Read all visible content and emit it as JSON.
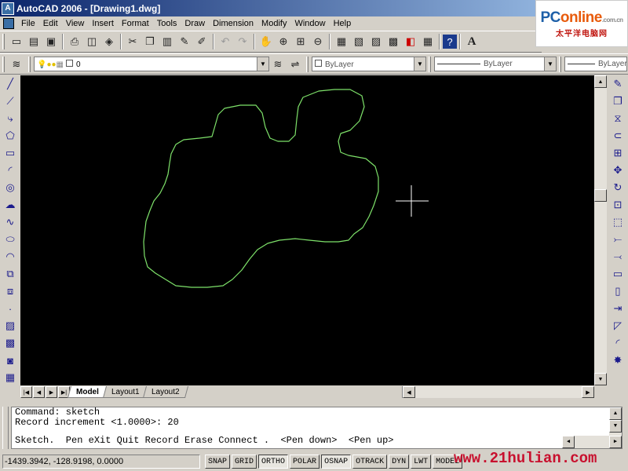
{
  "window": {
    "title": "AutoCAD 2006 - [Drawing1.dwg]"
  },
  "brand": {
    "logo_main_a": "PC",
    "logo_main_b": "online",
    "logo_domain": ".com.cn",
    "logo_sub": "太平洋电脑网"
  },
  "menu": [
    "File",
    "Edit",
    "View",
    "Insert",
    "Format",
    "Tools",
    "Draw",
    "Dimension",
    "Modify",
    "Window",
    "Help"
  ],
  "layers": {
    "current_layer": "0"
  },
  "properties": {
    "color": "ByLayer",
    "linetype": "ByLayer",
    "lineweight": "ByLayer"
  },
  "tabs": {
    "model": "Model",
    "layout1": "Layout1",
    "layout2": "Layout2"
  },
  "command": {
    "lines": [
      "Command: sketch",
      "Record increment <1.0000>: 20"
    ],
    "prompt": "Sketch.  Pen eXit Quit Record Erase Connect .  <Pen down>  <Pen up>"
  },
  "status": {
    "coords": "-1439.3942, -128.9198, 0.0000",
    "buttons": [
      "SNAP",
      "GRID",
      "ORTHO",
      "POLAR",
      "OSNAP",
      "OTRACK",
      "DYN",
      "LWT",
      "MODEL"
    ]
  },
  "watermark": "www.21hulian.com",
  "colors": {
    "sketch_stroke": "#7ee26a",
    "canvas": "#000000",
    "crosshair": "#ffffff",
    "title_start": "#0a246a",
    "title_end": "#a6caf0"
  }
}
